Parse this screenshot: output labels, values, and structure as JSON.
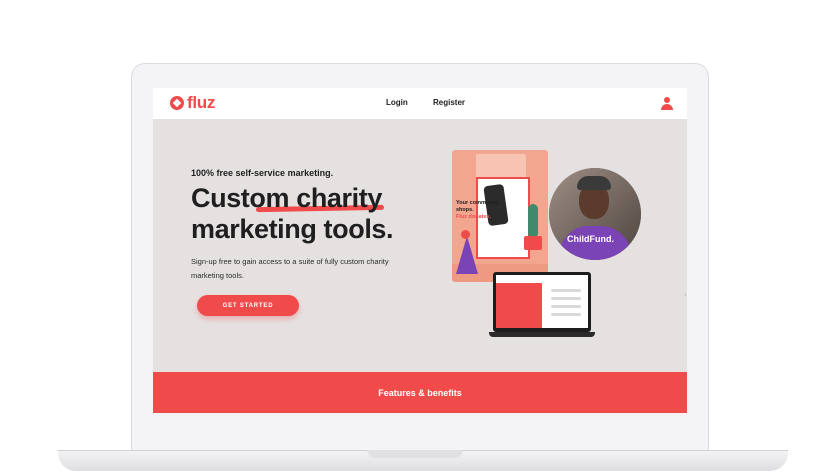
{
  "nav": {
    "logo_text": "fluz",
    "login_label": "Login",
    "register_label": "Register",
    "user_icon": "user-icon"
  },
  "hero": {
    "eyebrow": "100% free self-service marketing.",
    "headline_line1_prefix": "Custom ",
    "headline_line1_highlight": "charity",
    "headline_line2": "marketing tools.",
    "description": "Sign-up free to gain access to a suite of fully custom charity marketing tools.",
    "cta_label": "GET STARTED"
  },
  "illustrations": {
    "poster_line1": "Your community shops.",
    "poster_line2": "Fluz donates.",
    "portrait_label": "ChildFund."
  },
  "band": {
    "label": "Features & benefits"
  },
  "colors": {
    "brand": "#f04b4b",
    "hero_background": "#e6e1e1",
    "text": "#1f1f1f",
    "purple_accent": "#7a43b6"
  }
}
